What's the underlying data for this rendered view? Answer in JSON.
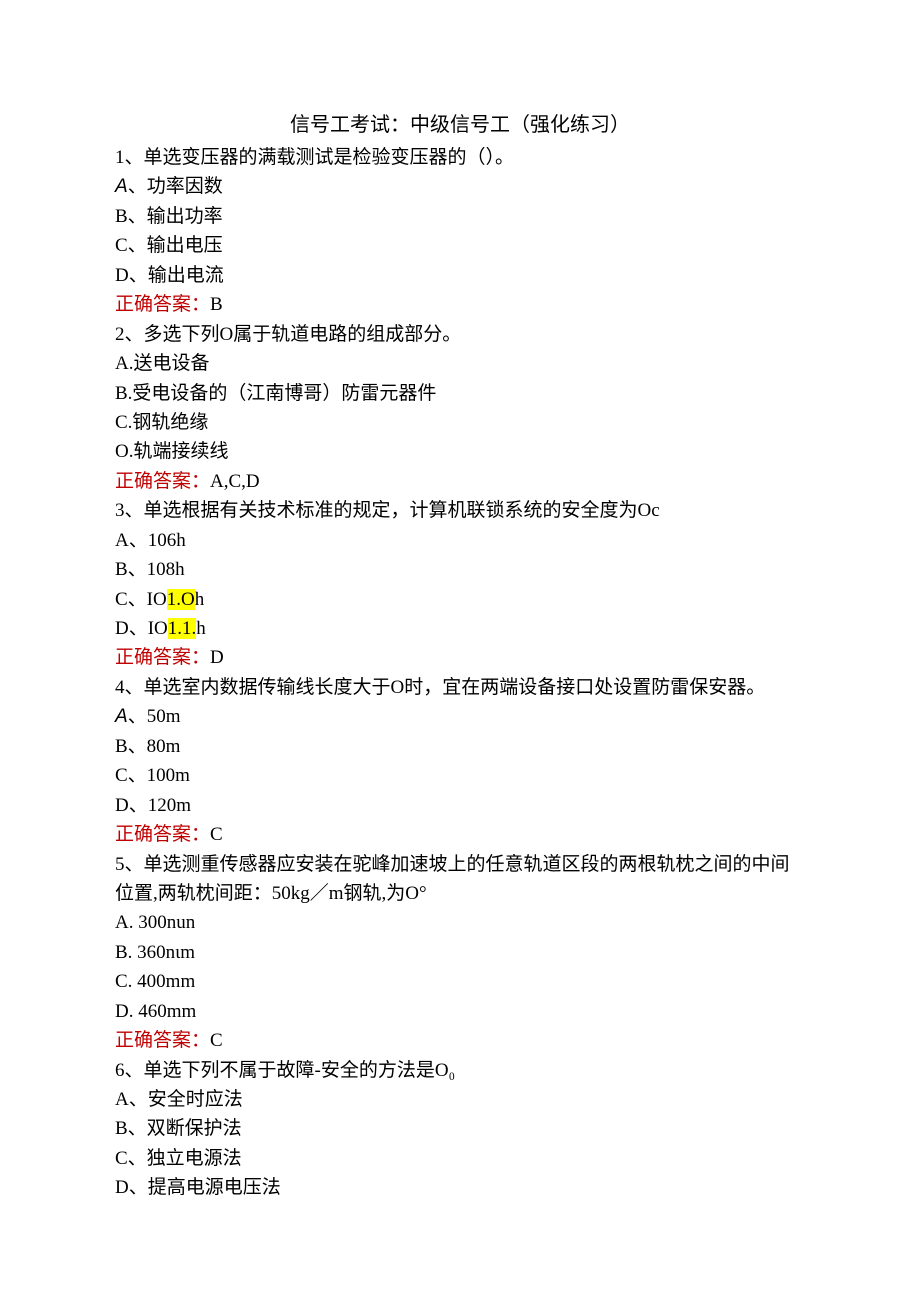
{
  "title": "信号工考试：中级信号工（强化练习）",
  "answer_label": "正确答案：",
  "q1": {
    "stem": "1、单选变压器的满载测试是检验变压器的（）。",
    "a_prefix": "A",
    "a_rest": "、功率因数",
    "b": "B、输出功率",
    "c": "C、输出电压",
    "d": "D、输出电流",
    "ans": "B"
  },
  "q2": {
    "stem": "2、多选下列O属于轨道电路的组成部分。",
    "a": "A.送电设备",
    "b": "B.受电设备的（江南博哥）防雷元器件",
    "c": "C.钢轨绝缘",
    "d": "O.轨端接续线",
    "ans": "A,C,D"
  },
  "q3": {
    "stem": "3、单选根据有关技术标准的规定，计算机联锁系统的安全度为Oc",
    "a": "A、106h",
    "b": "B、108h",
    "c_pre": "C、IO",
    "c_hl": "1.O",
    "c_post": "h",
    "d_pre": "D、IO",
    "d_hl": "1.1.",
    "d_post": "h",
    "ans": "D"
  },
  "q4": {
    "stem": "4、单选室内数据传输线长度大于O时，宜在两端设备接口处设置防雷保安器。",
    "a_prefix": "A",
    "a_rest": "、50m",
    "b": "B、80m",
    "c": "C、100m",
    "d": "D、120m",
    "ans": "C"
  },
  "q5": {
    "stem": "5、单选测重传感器应安装在驼峰加速坡上的任意轨道区段的两根轨枕之间的中间位置,两轨枕间距：50kg／m钢轨,为O°",
    "a": "A. 300nun",
    "b": "B. 360nιm",
    "c": "C. 400mm",
    "d": "D. 460mm",
    "ans": "C"
  },
  "q6": {
    "stem": "6、单选下列不属于故障-安全的方法是O₀",
    "a": "A、安全时应法",
    "b": "B、双断保护法",
    "c": "C、独立电源法",
    "d": "D、提高电源电压法"
  }
}
